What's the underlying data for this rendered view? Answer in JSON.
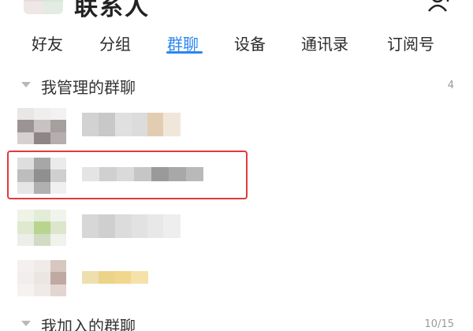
{
  "header": {
    "title": "联系人",
    "add_contact_icon": "add-contact-icon"
  },
  "tabs": [
    {
      "label": "好友",
      "active": false
    },
    {
      "label": "分组",
      "active": false
    },
    {
      "label": "群聊",
      "active": true
    },
    {
      "label": "设备",
      "active": false
    },
    {
      "label": "通讯录",
      "active": false
    },
    {
      "label": "订阅号",
      "active": false
    }
  ],
  "sections": {
    "managed": {
      "label": "我管理的群聊",
      "count": "4",
      "expanded": true
    },
    "joined": {
      "label": "我加入的群聊",
      "count": "10/15",
      "expanded": true
    }
  },
  "colors": {
    "accent": "#2a86f0",
    "highlight_box": "#e23a3a",
    "text_primary": "#2b2b2b",
    "count_text": "#9a9a9a"
  }
}
